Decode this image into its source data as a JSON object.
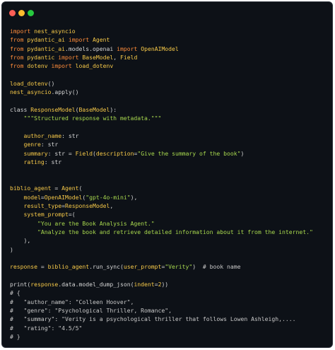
{
  "window": {
    "title_buttons": [
      "close",
      "minimize",
      "maximize"
    ],
    "colors": {
      "background": "#0d1117",
      "close": "#ff5f56",
      "minimize": "#ffbd2e",
      "maximize": "#27c93f",
      "keyword": "#ff8c3a",
      "function": "#f7c948",
      "string": "#a8d84e",
      "plain": "#d6d6d6"
    }
  },
  "code_lines": [
    [
      {
        "t": "import",
        "c": "kw"
      },
      {
        "t": " nest_asyncio",
        "c": "fn"
      }
    ],
    [
      {
        "t": "from",
        "c": "kw"
      },
      {
        "t": " pydantic_ai ",
        "c": "fn"
      },
      {
        "t": "import",
        "c": "kw"
      },
      {
        "t": " Agent",
        "c": "fn"
      }
    ],
    [
      {
        "t": "from",
        "c": "kw"
      },
      {
        "t": " pydantic_ai",
        "c": "fn"
      },
      {
        "t": ".models.openai ",
        "c": "pl"
      },
      {
        "t": "import",
        "c": "kw"
      },
      {
        "t": " OpenAIModel",
        "c": "fn"
      }
    ],
    [
      {
        "t": "from",
        "c": "kw"
      },
      {
        "t": " pydantic ",
        "c": "fn"
      },
      {
        "t": "import",
        "c": "kw"
      },
      {
        "t": " BaseModel",
        "c": "fn"
      },
      {
        "t": ", ",
        "c": "pl"
      },
      {
        "t": "Field",
        "c": "fn"
      }
    ],
    [
      {
        "t": "from",
        "c": "kw"
      },
      {
        "t": " dotenv ",
        "c": "fn"
      },
      {
        "t": "import",
        "c": "kw"
      },
      {
        "t": " load_dotenv",
        "c": "fn"
      }
    ],
    [],
    [
      {
        "t": "load_dotenv",
        "c": "fn"
      },
      {
        "t": "()",
        "c": "pl"
      }
    ],
    [
      {
        "t": "nest_asyncio",
        "c": "fn"
      },
      {
        "t": ".apply()",
        "c": "pl"
      }
    ],
    [],
    [
      {
        "t": "class ",
        "c": "pl"
      },
      {
        "t": "ResponseModel",
        "c": "fn"
      },
      {
        "t": "(",
        "c": "pl"
      },
      {
        "t": "BaseModel",
        "c": "fn"
      },
      {
        "t": "):",
        "c": "pl"
      }
    ],
    [
      {
        "t": "    \"\"\"Structured response with metadata.\"\"\"",
        "c": "str"
      }
    ],
    [],
    [
      {
        "t": "    ",
        "c": "pl"
      },
      {
        "t": "author_name",
        "c": "fn"
      },
      {
        "t": ": str",
        "c": "pl"
      }
    ],
    [
      {
        "t": "    ",
        "c": "pl"
      },
      {
        "t": "genre",
        "c": "fn"
      },
      {
        "t": ": str",
        "c": "pl"
      }
    ],
    [
      {
        "t": "    ",
        "c": "pl"
      },
      {
        "t": "summary",
        "c": "fn"
      },
      {
        "t": ": str = ",
        "c": "pl"
      },
      {
        "t": "Field",
        "c": "fn"
      },
      {
        "t": "(",
        "c": "pl"
      },
      {
        "t": "description",
        "c": "fn"
      },
      {
        "t": "=",
        "c": "pl"
      },
      {
        "t": "\"Give the summary of the book\"",
        "c": "str"
      },
      {
        "t": ")",
        "c": "pl"
      }
    ],
    [
      {
        "t": "    ",
        "c": "pl"
      },
      {
        "t": "rating",
        "c": "fn"
      },
      {
        "t": ": str",
        "c": "pl"
      }
    ],
    [],
    [],
    [
      {
        "t": "biblio_agent",
        "c": "fn"
      },
      {
        "t": " = ",
        "c": "pl"
      },
      {
        "t": "Agent",
        "c": "fn"
      },
      {
        "t": "(",
        "c": "pl"
      }
    ],
    [
      {
        "t": "    ",
        "c": "pl"
      },
      {
        "t": "model",
        "c": "fn"
      },
      {
        "t": "=",
        "c": "pl"
      },
      {
        "t": "OpenAIModel",
        "c": "fn"
      },
      {
        "t": "(",
        "c": "pl"
      },
      {
        "t": "\"gpt-4o-mini\"",
        "c": "str"
      },
      {
        "t": "),",
        "c": "pl"
      }
    ],
    [
      {
        "t": "    ",
        "c": "pl"
      },
      {
        "t": "result_type",
        "c": "fn"
      },
      {
        "t": "=",
        "c": "pl"
      },
      {
        "t": "ResponseModel",
        "c": "fn"
      },
      {
        "t": ",",
        "c": "pl"
      }
    ],
    [
      {
        "t": "    ",
        "c": "pl"
      },
      {
        "t": "system_prompt",
        "c": "fn"
      },
      {
        "t": "=(",
        "c": "pl"
      }
    ],
    [
      {
        "t": "        \"You are the Book Analysis Agent.\"",
        "c": "str"
      }
    ],
    [
      {
        "t": "        \"Analyze the book and retrieve detailed information about it from the internet.\"",
        "c": "str"
      }
    ],
    [
      {
        "t": "    ),",
        "c": "pl"
      }
    ],
    [
      {
        "t": ")",
        "c": "pl"
      }
    ],
    [],
    [
      {
        "t": "response",
        "c": "fn"
      },
      {
        "t": " = ",
        "c": "pl"
      },
      {
        "t": "biblio_agent",
        "c": "fn"
      },
      {
        "t": ".run_sync(",
        "c": "pl"
      },
      {
        "t": "user_prompt",
        "c": "fn"
      },
      {
        "t": "=",
        "c": "pl"
      },
      {
        "t": "\"Verity\"",
        "c": "str"
      },
      {
        "t": ")  ",
        "c": "pl"
      },
      {
        "t": "# book name",
        "c": "cm"
      }
    ],
    [],
    [
      {
        "t": "print(",
        "c": "pl"
      },
      {
        "t": "response",
        "c": "fn"
      },
      {
        "t": ".data.model_dump_json(",
        "c": "pl"
      },
      {
        "t": "indent",
        "c": "fn"
      },
      {
        "t": "=",
        "c": "pl"
      },
      {
        "t": "2",
        "c": "fn"
      },
      {
        "t": "))",
        "c": "pl"
      }
    ],
    [
      {
        "t": "# {",
        "c": "cm"
      }
    ],
    [
      {
        "t": "#   \"author_name\": \"Colleen Hoover\",",
        "c": "cm"
      }
    ],
    [
      {
        "t": "#   \"genre\": \"Psychological Thriller, Romance\",",
        "c": "cm"
      }
    ],
    [
      {
        "t": "#   \"summary\": \"Verity is a psychological thriller that follows Lowen Ashleigh,....",
        "c": "cm"
      }
    ],
    [
      {
        "t": "#   \"rating\": \"4.5/5\"",
        "c": "cm"
      }
    ],
    [
      {
        "t": "# }",
        "c": "cm"
      }
    ]
  ]
}
